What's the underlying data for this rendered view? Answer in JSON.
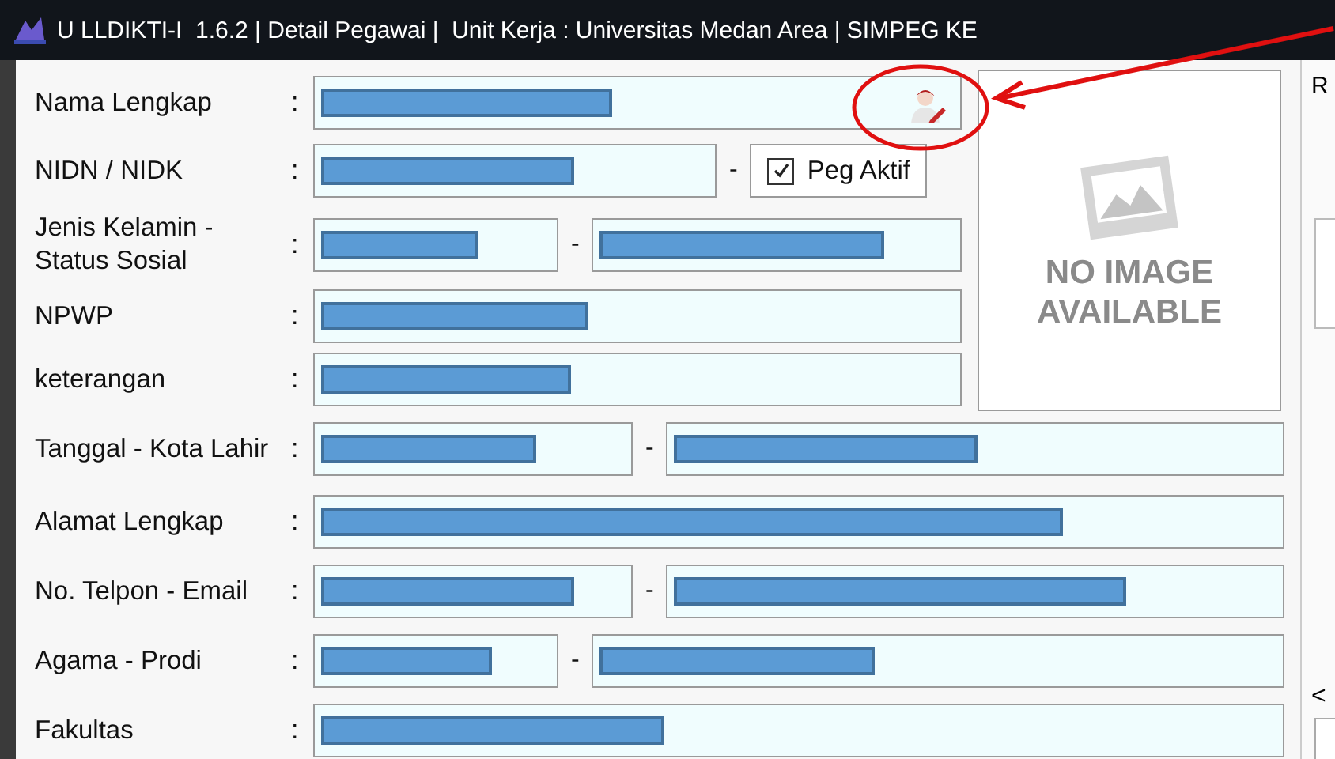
{
  "window": {
    "title": "U LLDIKTI-I  1.6.2 | Detail Pegawai |  Unit Kerja : Universitas Medan Area | SIMPEG KE"
  },
  "top_rows": [
    {
      "label": "Nama Lengkap",
      "colon": ":",
      "parts": [
        {
          "kind": "field",
          "redacted": true,
          "action_icon": true
        }
      ]
    },
    {
      "label": "NIDN / NIDK",
      "colon": ":",
      "parts": [
        {
          "kind": "field",
          "redacted": true
        },
        {
          "kind": "separator",
          "text": "-"
        },
        {
          "kind": "checkbox",
          "label": "Peg Aktif",
          "checked": true
        }
      ]
    },
    {
      "label": "Jenis Kelamin - Status Sosial",
      "colon": ":",
      "parts": [
        {
          "kind": "field",
          "redacted": true
        },
        {
          "kind": "separator",
          "text": "-"
        },
        {
          "kind": "field",
          "redacted": true
        }
      ]
    },
    {
      "label": "NPWP",
      "colon": ":",
      "parts": [
        {
          "kind": "field",
          "redacted": true
        }
      ]
    },
    {
      "label": "keterangan",
      "colon": ":",
      "parts": [
        {
          "kind": "field",
          "redacted": true
        }
      ]
    }
  ],
  "photo": {
    "text": "NO IMAGE AVAILABLE"
  },
  "bottom_rows": [
    {
      "label": "Tanggal - Kota Lahir",
      "colon": ":",
      "parts": [
        {
          "kind": "field",
          "redacted": true
        },
        {
          "kind": "separator",
          "text": "-"
        },
        {
          "kind": "field",
          "redacted": true
        }
      ]
    },
    {
      "label": "Alamat Lengkap",
      "colon": ":",
      "parts": [
        {
          "kind": "field",
          "redacted": true
        }
      ]
    },
    {
      "label": "No. Telpon - Email",
      "colon": ":",
      "parts": [
        {
          "kind": "field",
          "redacted": true
        },
        {
          "kind": "separator",
          "text": "-"
        },
        {
          "kind": "field",
          "redacted": true
        }
      ]
    },
    {
      "label": "Agama - Prodi",
      "colon": ":",
      "parts": [
        {
          "kind": "field",
          "redacted": true
        },
        {
          "kind": "separator",
          "text": "-"
        },
        {
          "kind": "field",
          "redacted": true
        }
      ]
    },
    {
      "label": "Fakultas",
      "colon": ":",
      "parts": [
        {
          "kind": "field",
          "redacted": true
        }
      ]
    }
  ],
  "right_panel": {
    "label": "R",
    "scroll_arrow": "<"
  },
  "annotation": {
    "circle": true,
    "arrow": true
  }
}
